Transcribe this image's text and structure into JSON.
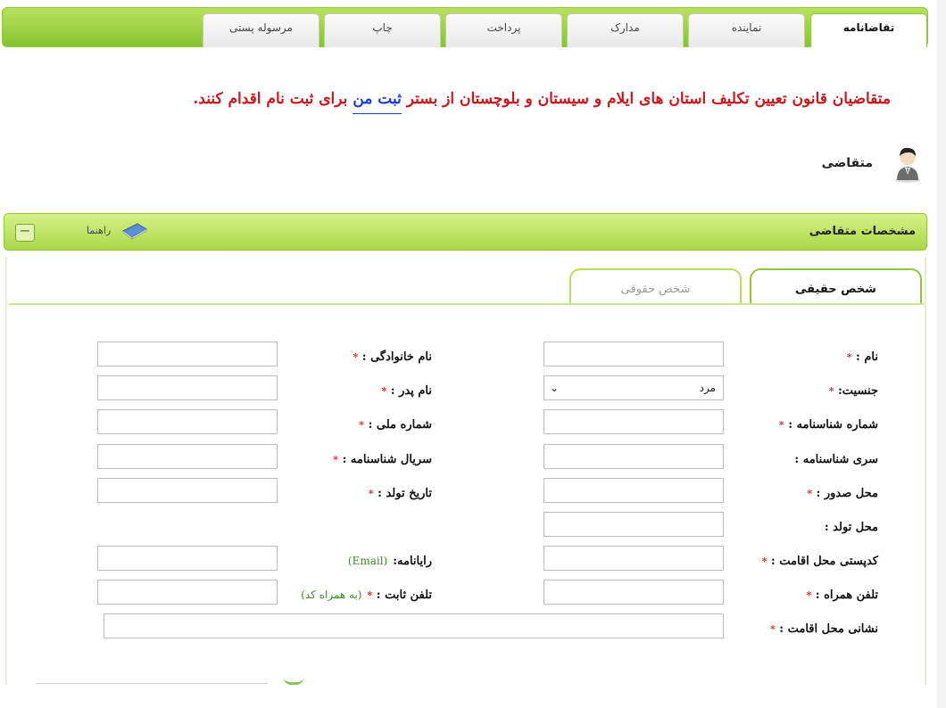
{
  "tabs": [
    {
      "label": "تقاضانامه",
      "active": true
    },
    {
      "label": "نماینده",
      "active": false
    },
    {
      "label": "مدارک",
      "active": false
    },
    {
      "label": "پرداخت",
      "active": false
    },
    {
      "label": "چاپ",
      "active": false
    },
    {
      "label": "مرسوله پستی",
      "active": false
    }
  ],
  "notice": {
    "before": "متقاضیان قانون تعیین تکلیف استان های ایلام و سیستان و بلوچستان از بستر ",
    "link_part1": "ثبت",
    "link_part2": "من",
    "after": " برای ثبت نام اقدام کنند."
  },
  "applicant_title": "متقاضی",
  "section": {
    "title": "مشخصات متقاضی",
    "help": "راهنما",
    "collapse": "−"
  },
  "subtabs": {
    "natural": "شخص حقیقی",
    "legal": "شخص حقوقی"
  },
  "required_mark": "*",
  "form": {
    "first_name": "نام :",
    "last_name": "نام خانوادگی :",
    "gender": "جنسیت:",
    "gender_value": "مرد",
    "father_name": "نام پدر :",
    "id_number": "شماره شناسنامه :",
    "national_code": "شماره ملی :",
    "id_series": "سری شناسنامه :",
    "id_serial": "سریال شناسنامه :",
    "issue_place": "محل صدور :",
    "birth_date": "تاریخ تولد :",
    "birth_place": "محل تولد :",
    "postal_code": "کدپستی محل اقامت :",
    "email": "رایانامه:",
    "email_hint": "(Email)",
    "mobile": "تلفن همراه :",
    "phone": "تلفن ثابت :",
    "phone_hint": "(به همراه کد)",
    "address": "نشانی محل اقامت :"
  },
  "colors": {
    "accent_green": "#a9d94a",
    "notice_red": "#c8171d",
    "link_blue": "#1a3bd6",
    "required_red": "#d42a2a"
  }
}
